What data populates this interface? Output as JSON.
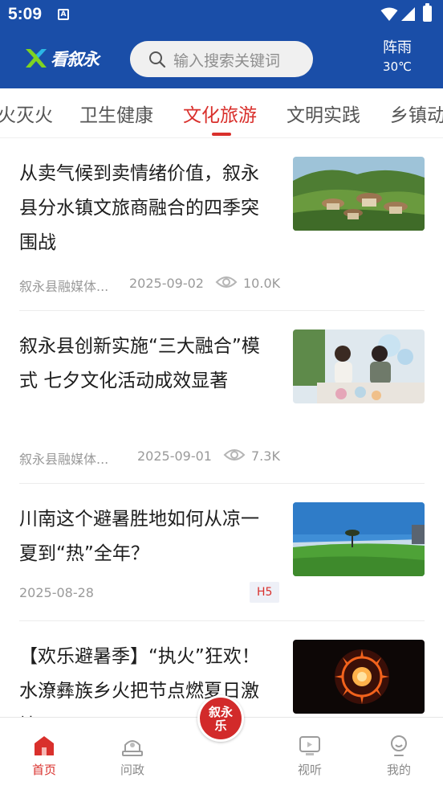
{
  "status_bar": {
    "time": "5:09",
    "notif_glyph": "A"
  },
  "header": {
    "logo_text": "看叙永",
    "search_placeholder": "输入搜索关键词",
    "weather": {
      "condition": "阵雨",
      "temperature": "30℃"
    }
  },
  "tabs": [
    {
      "label": "火灭火"
    },
    {
      "label": "卫生健康"
    },
    {
      "label": "文化旅游",
      "active": true
    },
    {
      "label": "文明实践"
    },
    {
      "label": "乡镇动态"
    }
  ],
  "articles": [
    {
      "title": "从卖气候到卖情绪价值，叙永县分水镇文旅商融合的四季突围战",
      "source": "叙永县融媒体...",
      "date": "2025-09-02",
      "views": "10.0K",
      "thumb": "green-hills-mushroom-huts"
    },
    {
      "title": "叙永县创新实施“三大融合”模式 七夕文化活动成效显著",
      "source": "叙永县融媒体...",
      "date": "2025-09-01",
      "views": "7.3K",
      "thumb": "couple-painting-fans"
    },
    {
      "title": "川南这个避暑胜地如何从凉一夏到“热”全年？",
      "date": "2025-08-28",
      "badge": "H5",
      "thumb": "grassland-blue-sky"
    },
    {
      "title": "【欢乐避暑季】“执火”狂欢！水潦彝族乡火把节点燃夏日激情",
      "thumb": "fire-wheel-night"
    }
  ],
  "bottom_nav": [
    {
      "label": "首页",
      "icon": "home-icon",
      "active": true
    },
    {
      "label": "问政",
      "icon": "petition-icon"
    },
    {
      "label": "视听",
      "icon": "tv-icon"
    },
    {
      "label": "我的",
      "icon": "profile-icon"
    }
  ],
  "center_button": {
    "text": "叙永 乐"
  },
  "colors": {
    "brand_blue": "#1a4ea8",
    "accent_red": "#d9302c"
  }
}
